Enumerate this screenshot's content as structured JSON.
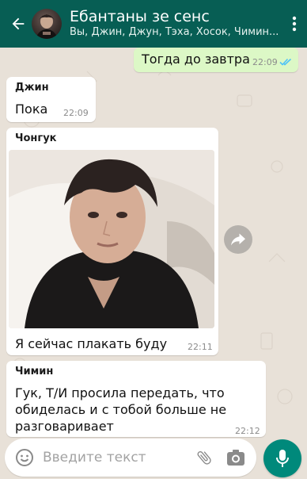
{
  "header": {
    "title": "Ебантаны зе сенс",
    "subtitle": "Вы, Джин, Джун, Тэха, Хосок, Чимин..."
  },
  "messages": [
    {
      "direction": "out",
      "text": "Тогда до завтра",
      "time": "22:09",
      "status": "read"
    },
    {
      "direction": "in",
      "sender": "Джин",
      "text": "Пока",
      "time": "22:09"
    },
    {
      "direction": "in",
      "sender": "Чонгук",
      "attachment": "photo",
      "text": "Я сейчас плакать буду",
      "time": "22:11"
    },
    {
      "direction": "in",
      "sender": "Чимин",
      "text": "Гук, Т/И просила передать, что обиделась и с тобой больше не разговаривает",
      "time": "22:12"
    }
  ],
  "composer": {
    "placeholder": "Введите текст"
  },
  "colors": {
    "header": "#075e54",
    "outgoing_bubble": "#dcf8c6",
    "incoming_bubble": "#ffffff",
    "chat_background": "#e8e1d8",
    "read_ticks": "#4fc3f7",
    "mic_button": "#00897b"
  },
  "icons": [
    "back-arrow-icon",
    "group-avatar",
    "more-vert-icon",
    "read-ticks-icon",
    "share-forward-icon",
    "emoji-icon",
    "attach-icon",
    "camera-icon",
    "mic-icon"
  ]
}
